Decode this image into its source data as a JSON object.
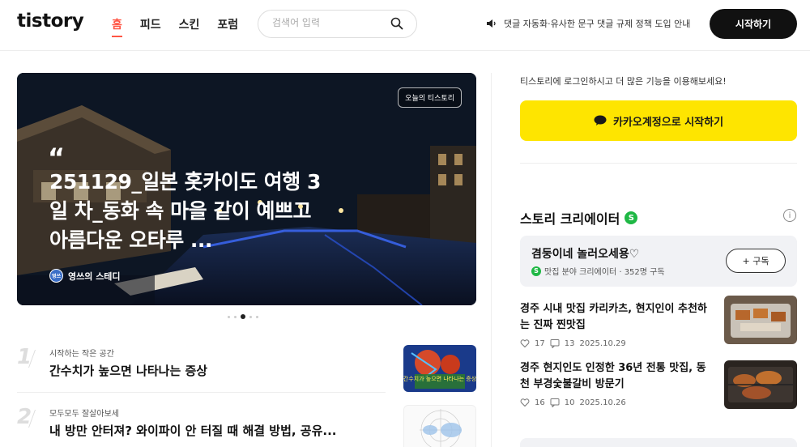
{
  "header": {
    "logo": "tistory",
    "nav": [
      "홈",
      "피드",
      "스킨",
      "포럼"
    ],
    "search_placeholder": "검색어 입력",
    "notice": "댓글 자동화·유사한 문구 댓글 규제 정책 도입 안내",
    "start_button": "시작하기"
  },
  "hero": {
    "badge": "오늘의 티스토리",
    "quote_mark": "“",
    "title": "251129_일본 홋카이도 여행 3일 차_동화 속 마을 같이 예쁘고 아름다운 오타루 ...",
    "author": "영쓰의 스테디",
    "author_avatar_text": "영쓰",
    "pager_count": 5,
    "pager_active_index": 2
  },
  "ranking": [
    {
      "rank": "1",
      "category": "시작하는 작은 공간",
      "title": "간수치가 높으면 나타나는 증상",
      "thumb_text": "간수치가 높으면 나타나는 증상"
    },
    {
      "rank": "2",
      "category": "모두모두 잘살아보세",
      "title": "내 방만 안터져? 와이파이 안 터질 때 해결 방법, 공유..."
    }
  ],
  "sidebar": {
    "login_text": "티스토리에 로그인하시고 더 많은 기능을 이용해보세요!",
    "kakao_button": "카카오계정으로 시작하기",
    "creator_heading": "스토리 크리에이터",
    "badge_letter": "S",
    "info_icon_text": "i",
    "creator": {
      "name": "겸둥이네 놀러오세용♡",
      "meta": "맛집 분야 크리에이터 · 352명 구독",
      "subscribe": "+ 구독"
    },
    "posts": [
      {
        "title": "경주 시내 맛집 카리카츠, 현지인이 추천하는 진짜 찐맛집",
        "likes": "17",
        "comments": "13",
        "date": "2025.10.29"
      },
      {
        "title": "경주 현지인도 인정한 36년 전통 맛집, 동천 부경숯불갈비 방문기",
        "likes": "16",
        "comments": "10",
        "date": "2025.10.26"
      }
    ]
  },
  "colors": {
    "accent": "#ff5544",
    "kakao": "#fee500",
    "creator_badge": "#1fb845"
  }
}
